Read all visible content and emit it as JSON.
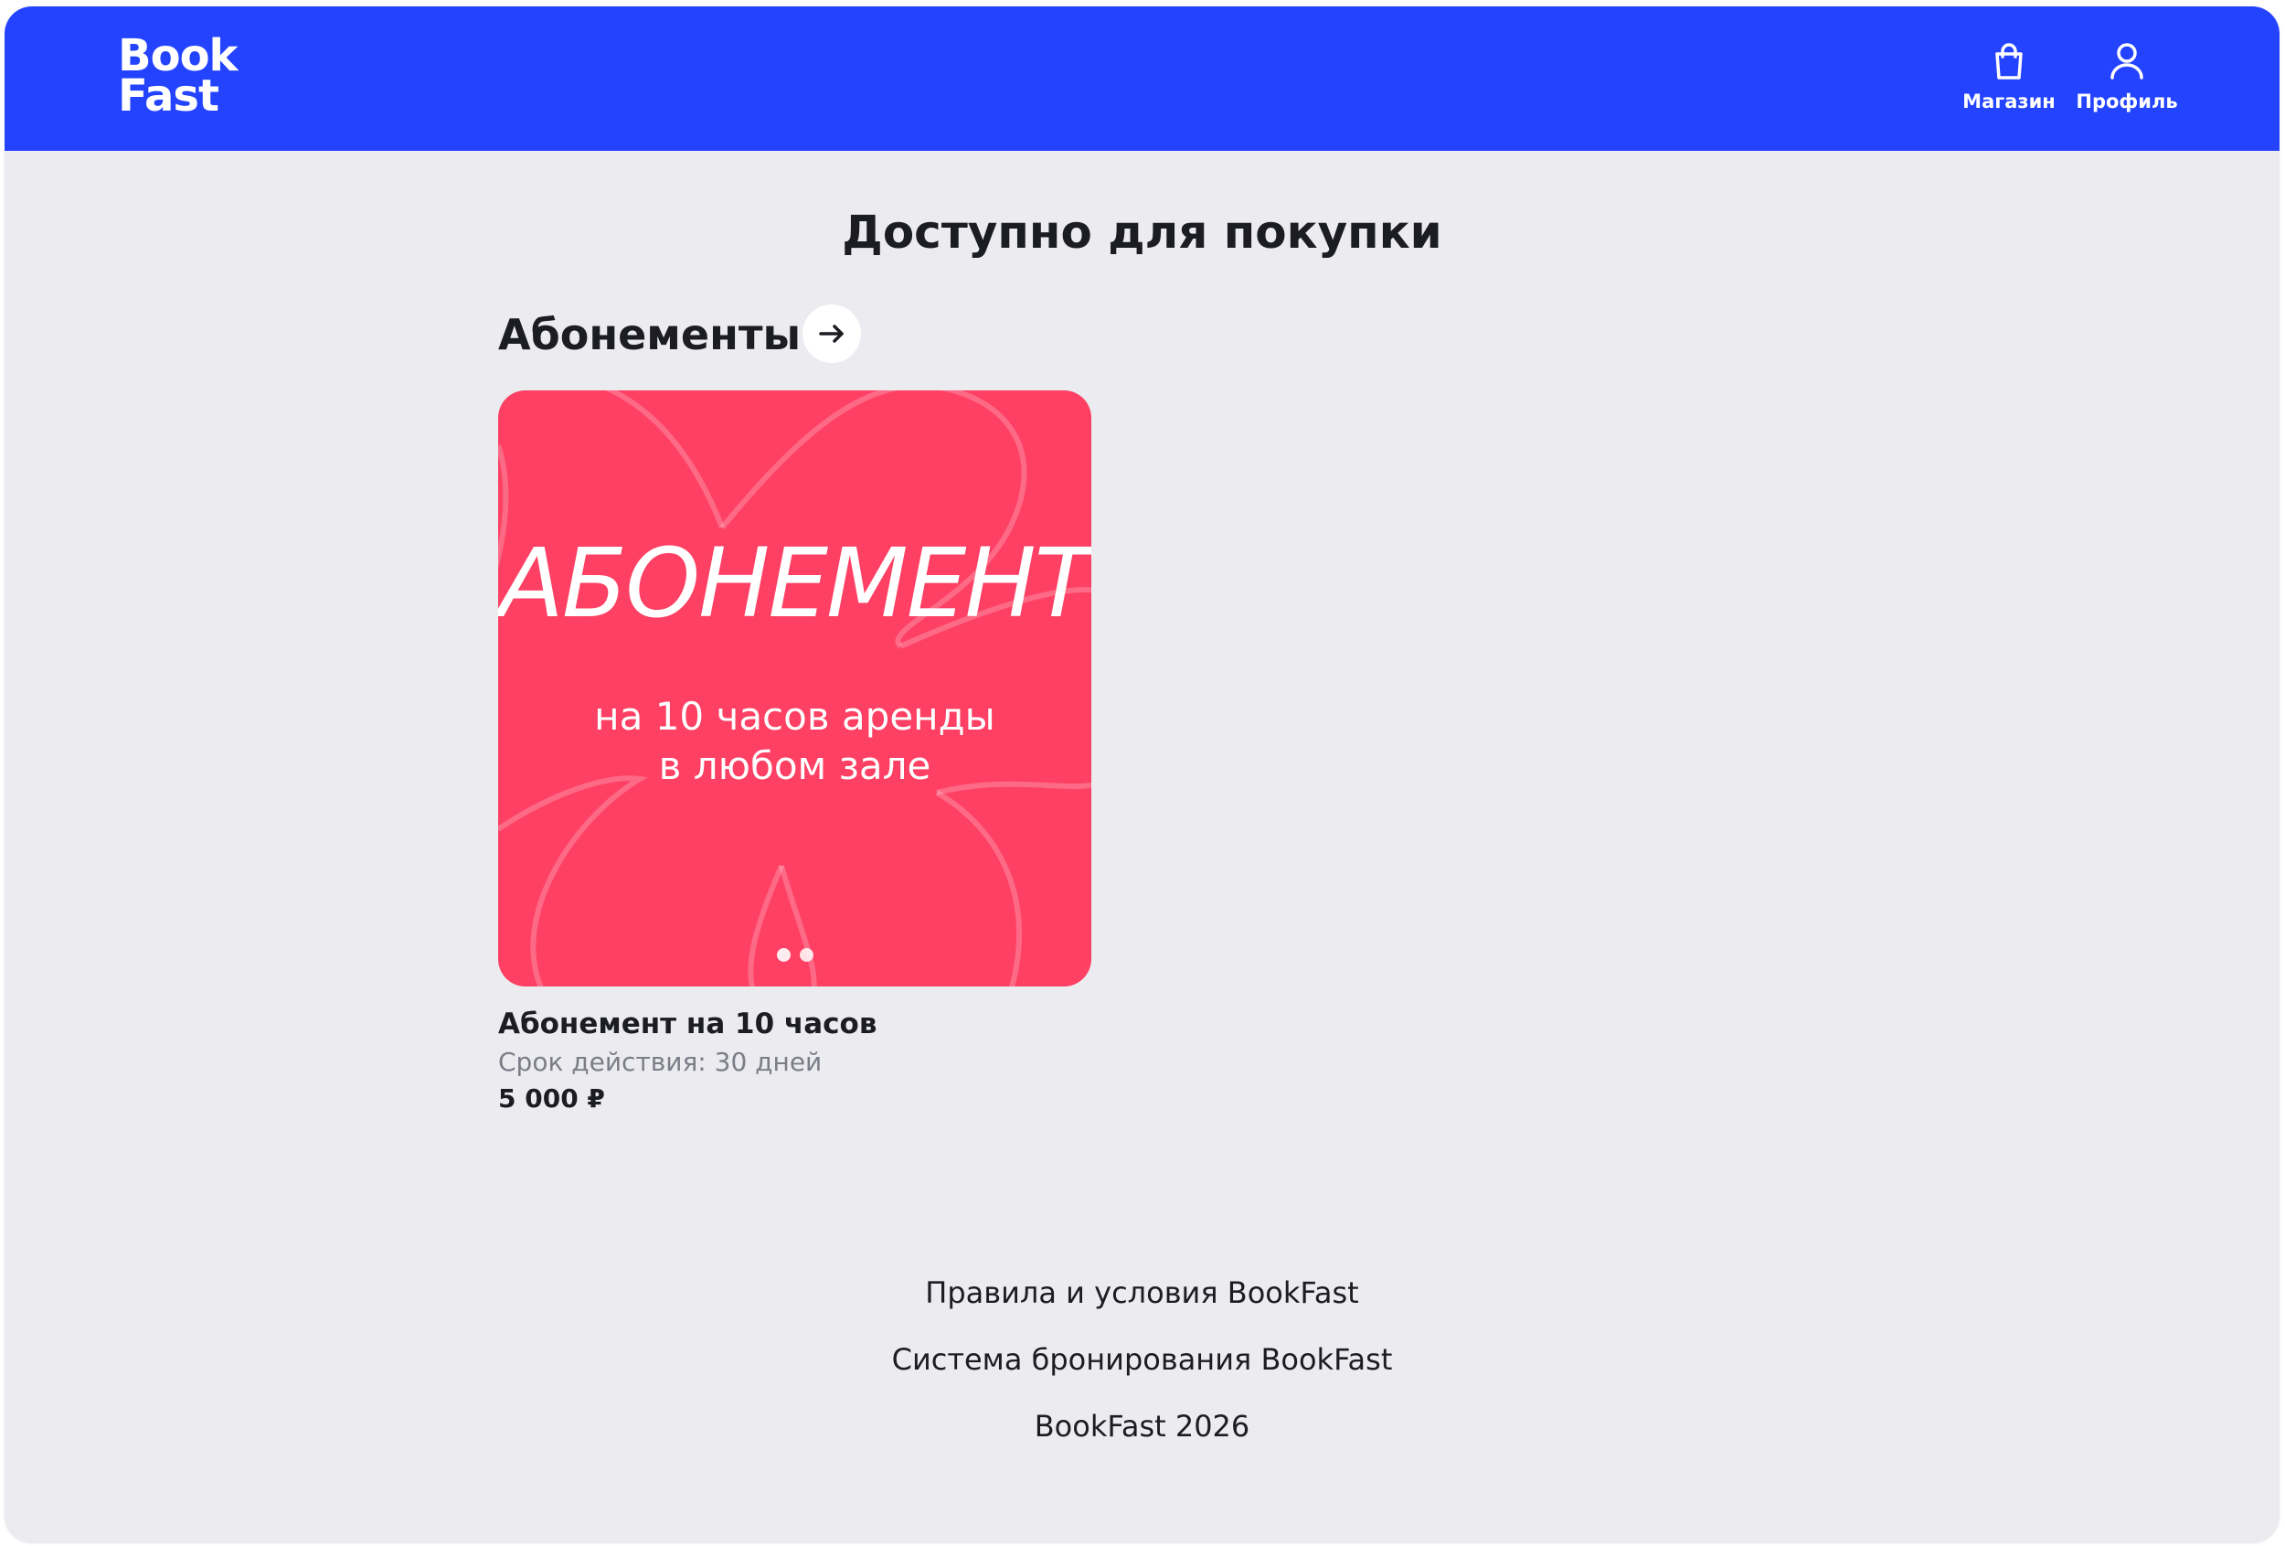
{
  "header": {
    "logo_line1": "Book",
    "logo_line2": "Fast",
    "nav": {
      "shop_label": "Магазин",
      "profile_label": "Профиль"
    },
    "color": "#2343ff"
  },
  "page": {
    "title": "Доступно для покупки"
  },
  "section": {
    "title": "Абонементы",
    "arrow_icon": "arrow-right-icon"
  },
  "product": {
    "image": {
      "headline": "АБОНЕМЕНТ",
      "subtitle_line1": "на 10 часов аренды",
      "subtitle_line2": "в любом зале",
      "background_color": "#fd4063",
      "slide_count": 2,
      "active_slide": 1
    },
    "name": "Абонемент на 10 часов",
    "validity": "Срок действия: 30 дней",
    "price": "5 000 ₽"
  },
  "footer": {
    "terms": "Правила и условия BookFast",
    "booking_system": "Система бронирования BookFast",
    "copyright": "BookFast 2026"
  }
}
